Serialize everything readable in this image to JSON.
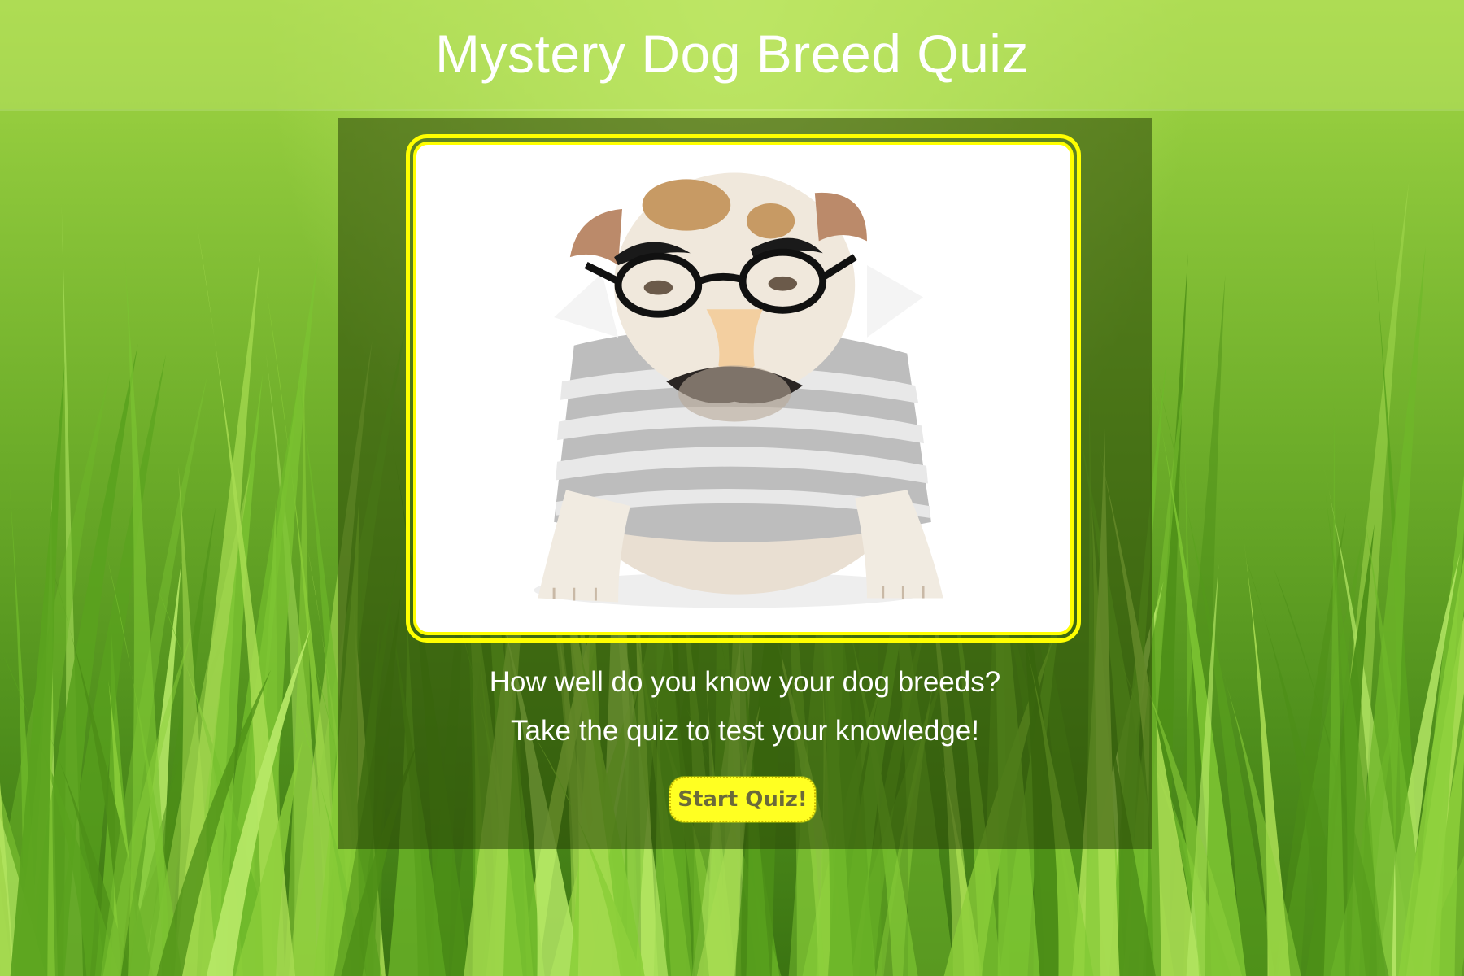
{
  "header": {
    "title": "Mystery Dog Breed Quiz"
  },
  "main": {
    "image": {
      "icon": "bulldog-with-groucho-glasses-photo"
    },
    "intro": {
      "line1": "How well do you know your dog breeds?",
      "line2": "Take the quiz to test your knowledge!"
    },
    "start_button": {
      "label": "Start Quiz!"
    }
  },
  "colors": {
    "accent": "#ffff00",
    "button_bg": "#ffff22",
    "button_text": "#6b6a3a",
    "panel": "#284206",
    "grass": "#6eae2a"
  }
}
